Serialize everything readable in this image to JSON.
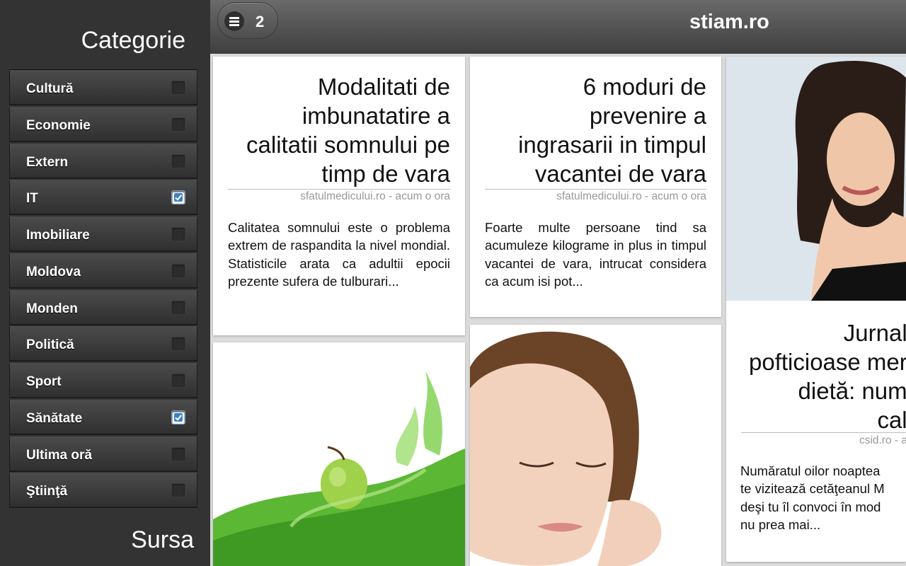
{
  "sidebar": {
    "category_heading": "Categorie",
    "source_heading": "Sursa",
    "categories": [
      {
        "label": "Cultură",
        "checked": false
      },
      {
        "label": "Economie",
        "checked": false
      },
      {
        "label": "Extern",
        "checked": false
      },
      {
        "label": "IT",
        "checked": true
      },
      {
        "label": "Imobiliare",
        "checked": false
      },
      {
        "label": "Moldova",
        "checked": false
      },
      {
        "label": "Monden",
        "checked": false
      },
      {
        "label": "Politică",
        "checked": false
      },
      {
        "label": "Sport",
        "checked": false
      },
      {
        "label": "Sănătate",
        "checked": true
      },
      {
        "label": "Ultima oră",
        "checked": false
      },
      {
        "label": "Ştiinţă",
        "checked": false
      }
    ]
  },
  "header": {
    "menu_icon": "hamburger-menu-icon",
    "menu_count": "2",
    "site_title": "stiam.ro"
  },
  "articles": [
    {
      "title": "Modalitati de imbunatatire a calitatii somnului pe timp de vara",
      "meta": "sfatulmedicului.ro - acum o ora",
      "excerpt": "Calitatea somnului este o problema extrem de raspandita la nivel mondial. Statisticile arata ca adultii epocii prezente sufera de tulburari..."
    },
    {
      "title": "6 moduri de prevenire a ingrasarii in timpul vacantei de vara",
      "meta": "sfatulmedicului.ro - acum o ora",
      "excerpt": "Foarte multe persoane tind sa acumuleze kilograme in plus in timpul vacantei de vara, intrucat considera ca acum isi pot..."
    },
    {
      "title": "Jurnalu... pofticioase me... dietă: numa... calo...",
      "title_lines": [
        "Jurnalu",
        "pofticioase mer",
        "dietă: numa",
        "calo"
      ],
      "meta": "csid.ro - a",
      "excerpt_lines": [
        "Număratul oilor noaptea",
        "te vizitează cetăţeanul M",
        "deşi tu îl convoci în mod",
        "nu prea mai..."
      ]
    }
  ],
  "images": [
    "green-apple-splash-photo",
    "woman-face-skincare-photo",
    "woman-with-scale-photo"
  ],
  "colors": {
    "sidebar_bg": "#333333",
    "topbar_bg": "#555555",
    "checkbox_accent": "#3c82c4",
    "page_bg": "#dcdcdc"
  }
}
